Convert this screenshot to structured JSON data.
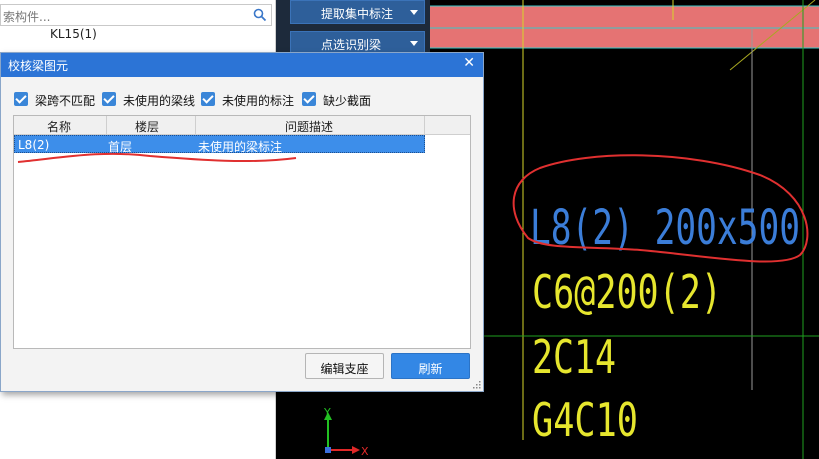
{
  "tree_panel": {
    "search_placeholder": "索构件...",
    "item": "KL15(1)"
  },
  "toolbar": {
    "buttons": [
      {
        "label": "提取集中标注"
      },
      {
        "label": "点选识别梁"
      }
    ]
  },
  "dialog": {
    "title": "校核梁图元",
    "filters": [
      {
        "label": "梁跨不匹配",
        "checked": true
      },
      {
        "label": "未使用的梁线",
        "checked": true
      },
      {
        "label": "未使用的标注",
        "checked": true
      },
      {
        "label": "缺少截面",
        "checked": true
      }
    ],
    "columns": [
      "名称",
      "楼层",
      "问题描述"
    ],
    "rows": [
      {
        "name": "L8(2)",
        "floor": "首层",
        "issue": "未使用的梁标注",
        "selected": true
      }
    ],
    "buttons": {
      "edit": "编辑支座",
      "refresh": "刷新"
    }
  },
  "canvas": {
    "annotation_lines": [
      "L8(2) 200x500",
      "C6@200(2)",
      "2C14",
      "G4C10"
    ],
    "colors": {
      "beam_fill": "#e57373",
      "cyan_line": "#39c7c7",
      "yellow_text": "#e6e62e",
      "blue_text": "#3b7dd8",
      "green_line": "#1fa11f",
      "red_markup": "#e03030"
    },
    "axis_labels": {
      "x": "X",
      "y": "Y"
    }
  }
}
